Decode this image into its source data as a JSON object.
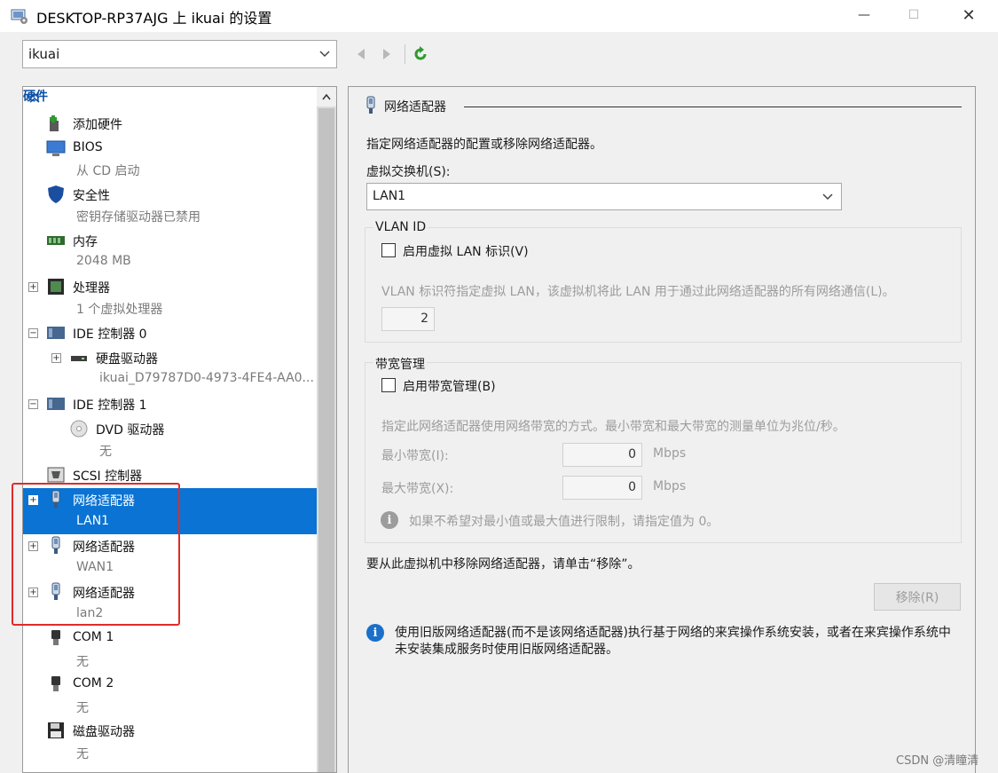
{
  "window": {
    "title": "DESKTOP-RP37AJG 上 ikuai 的设置",
    "minimize_glyph": "—",
    "maximize_glyph": "☐",
    "close_glyph": "✕"
  },
  "toolbar": {
    "vm_select_value": "ikuai"
  },
  "tree": {
    "section_label": "硬件",
    "items": [
      {
        "label": "添加硬件",
        "sub": "",
        "icon": "add-hardware-icon"
      },
      {
        "label": "BIOS",
        "sub": "从 CD 启动",
        "icon": "bios-icon"
      },
      {
        "label": "安全性",
        "sub": "密钥存储驱动器已禁用",
        "icon": "shield-icon"
      },
      {
        "label": "内存",
        "sub": "2048 MB",
        "icon": "memory-icon"
      },
      {
        "label": "处理器",
        "sub": "1 个虚拟处理器",
        "icon": "processor-icon",
        "expander": "+"
      },
      {
        "label": "IDE 控制器 0",
        "sub": "",
        "icon": "ide-controller-icon",
        "expander": "−"
      },
      {
        "label": "硬盘驱动器",
        "sub": "ikuai_D79787D0-4973-4FE4-AA0...",
        "icon": "hard-drive-icon",
        "expander": "+"
      },
      {
        "label": "IDE 控制器 1",
        "sub": "",
        "icon": "ide-controller-icon",
        "expander": "−"
      },
      {
        "label": "DVD 驱动器",
        "sub": "无",
        "icon": "dvd-icon"
      },
      {
        "label": "SCSI 控制器",
        "sub": "",
        "icon": "scsi-icon"
      },
      {
        "label": "网络适配器",
        "sub": "LAN1",
        "icon": "network-adapter-icon",
        "expander": "+",
        "selected": true
      },
      {
        "label": "网络适配器",
        "sub": "WAN1",
        "icon": "network-adapter-icon",
        "expander": "+"
      },
      {
        "label": "网络适配器",
        "sub": "lan2",
        "icon": "network-adapter-icon",
        "expander": "+"
      },
      {
        "label": "COM 1",
        "sub": "无",
        "icon": "com-port-icon"
      },
      {
        "label": "COM 2",
        "sub": "无",
        "icon": "com-port-icon"
      },
      {
        "label": "磁盘驱动器",
        "sub": "无",
        "icon": "floppy-icon"
      }
    ]
  },
  "panel": {
    "title": "网络适配器",
    "description": "指定网络适配器的配置或移除网络适配器。",
    "switch_label": "虚拟交换机(S):",
    "switch_value": "LAN1",
    "vlan_group": "VLAN ID",
    "vlan_checkbox": "启用虚拟 LAN 标识(V)",
    "vlan_desc": "VLAN 标识符指定虚拟 LAN，该虚拟机将此 LAN 用于通过此网络适配器的所有网络通信(L)。",
    "vlan_value": "2",
    "bw_group": "带宽管理",
    "bw_checkbox": "启用带宽管理(B)",
    "bw_desc": "指定此网络适配器使用网络带宽的方式。最小带宽和最大带宽的测量单位为兆位/秒。",
    "min_label": "最小带宽(I):",
    "min_value": "0",
    "max_label": "最大带宽(X):",
    "max_value": "0",
    "unit": "Mbps",
    "bw_hint": "如果不希望对最小值或最大值进行限制，请指定值为 0。",
    "remove_desc": "要从此虚拟机中移除网络适配器，请单击“移除”。",
    "remove_button": "移除(R)",
    "legacy_info": "使用旧版网络适配器(而不是该网络适配器)执行基于网络的来宾操作系统安装，或者在来宾操作系统中未安装集成服务时使用旧版网络适配器。"
  },
  "watermark": "CSDN @清瞳清",
  "colors": {
    "selection": "#0a73d3",
    "highlight": "#e02b2b",
    "section_head": "#0b4fa6",
    "info_blue": "#1a6fc9",
    "refresh_green": "#2e9b2e"
  }
}
